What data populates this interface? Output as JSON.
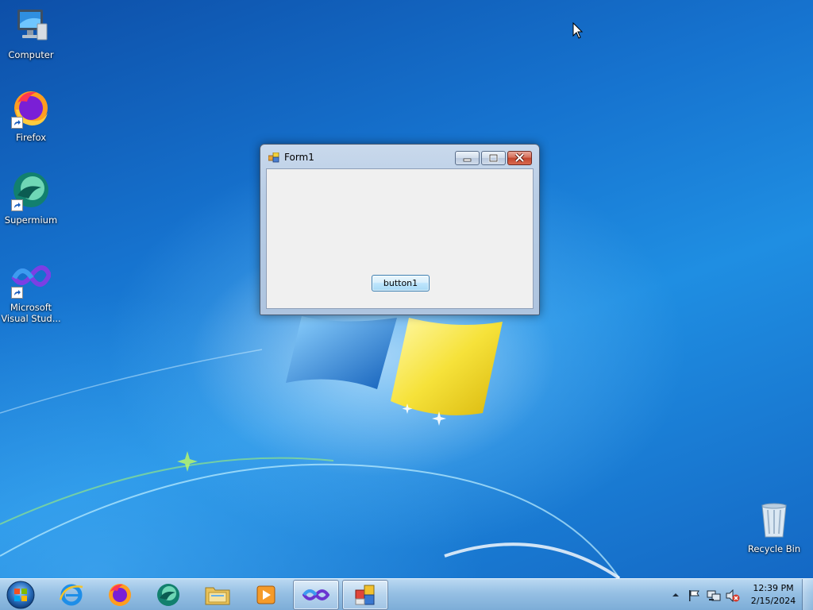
{
  "desktop": {
    "icons": [
      {
        "label": "Computer",
        "icon": "computer-icon"
      },
      {
        "label": "Firefox",
        "icon": "firefox-icon"
      },
      {
        "label": "Supermium",
        "icon": "supermium-icon"
      },
      {
        "label_line1": "Microsoft",
        "label_line2": "Visual Stud...",
        "icon": "visual-studio-icon"
      },
      {
        "label": "Recycle Bin",
        "icon": "recycle-bin-icon"
      }
    ]
  },
  "form_window": {
    "title": "Form1",
    "button1_label": "button1",
    "controls": [
      "minimize",
      "maximize",
      "close"
    ]
  },
  "taskbar": {
    "pinned": [
      "start-orb-icon",
      "internet-explorer-icon",
      "firefox-icon",
      "supermium-icon",
      "file-explorer-icon",
      "media-player-icon",
      "visual-studio-icon",
      "form1-app-icon"
    ],
    "tray_icons": [
      "show-hidden-icons-arrow",
      "action-center-flag-icon",
      "network-icon",
      "volume-muted-icon"
    ],
    "clock_time": "12:39 PM",
    "clock_date": "2/15/2024"
  },
  "colors": {
    "wallpaper": "#1673cf",
    "taskbar": "#a9c9e6",
    "close_button": "#c2452d",
    "button_border": "#3c7fb1"
  }
}
